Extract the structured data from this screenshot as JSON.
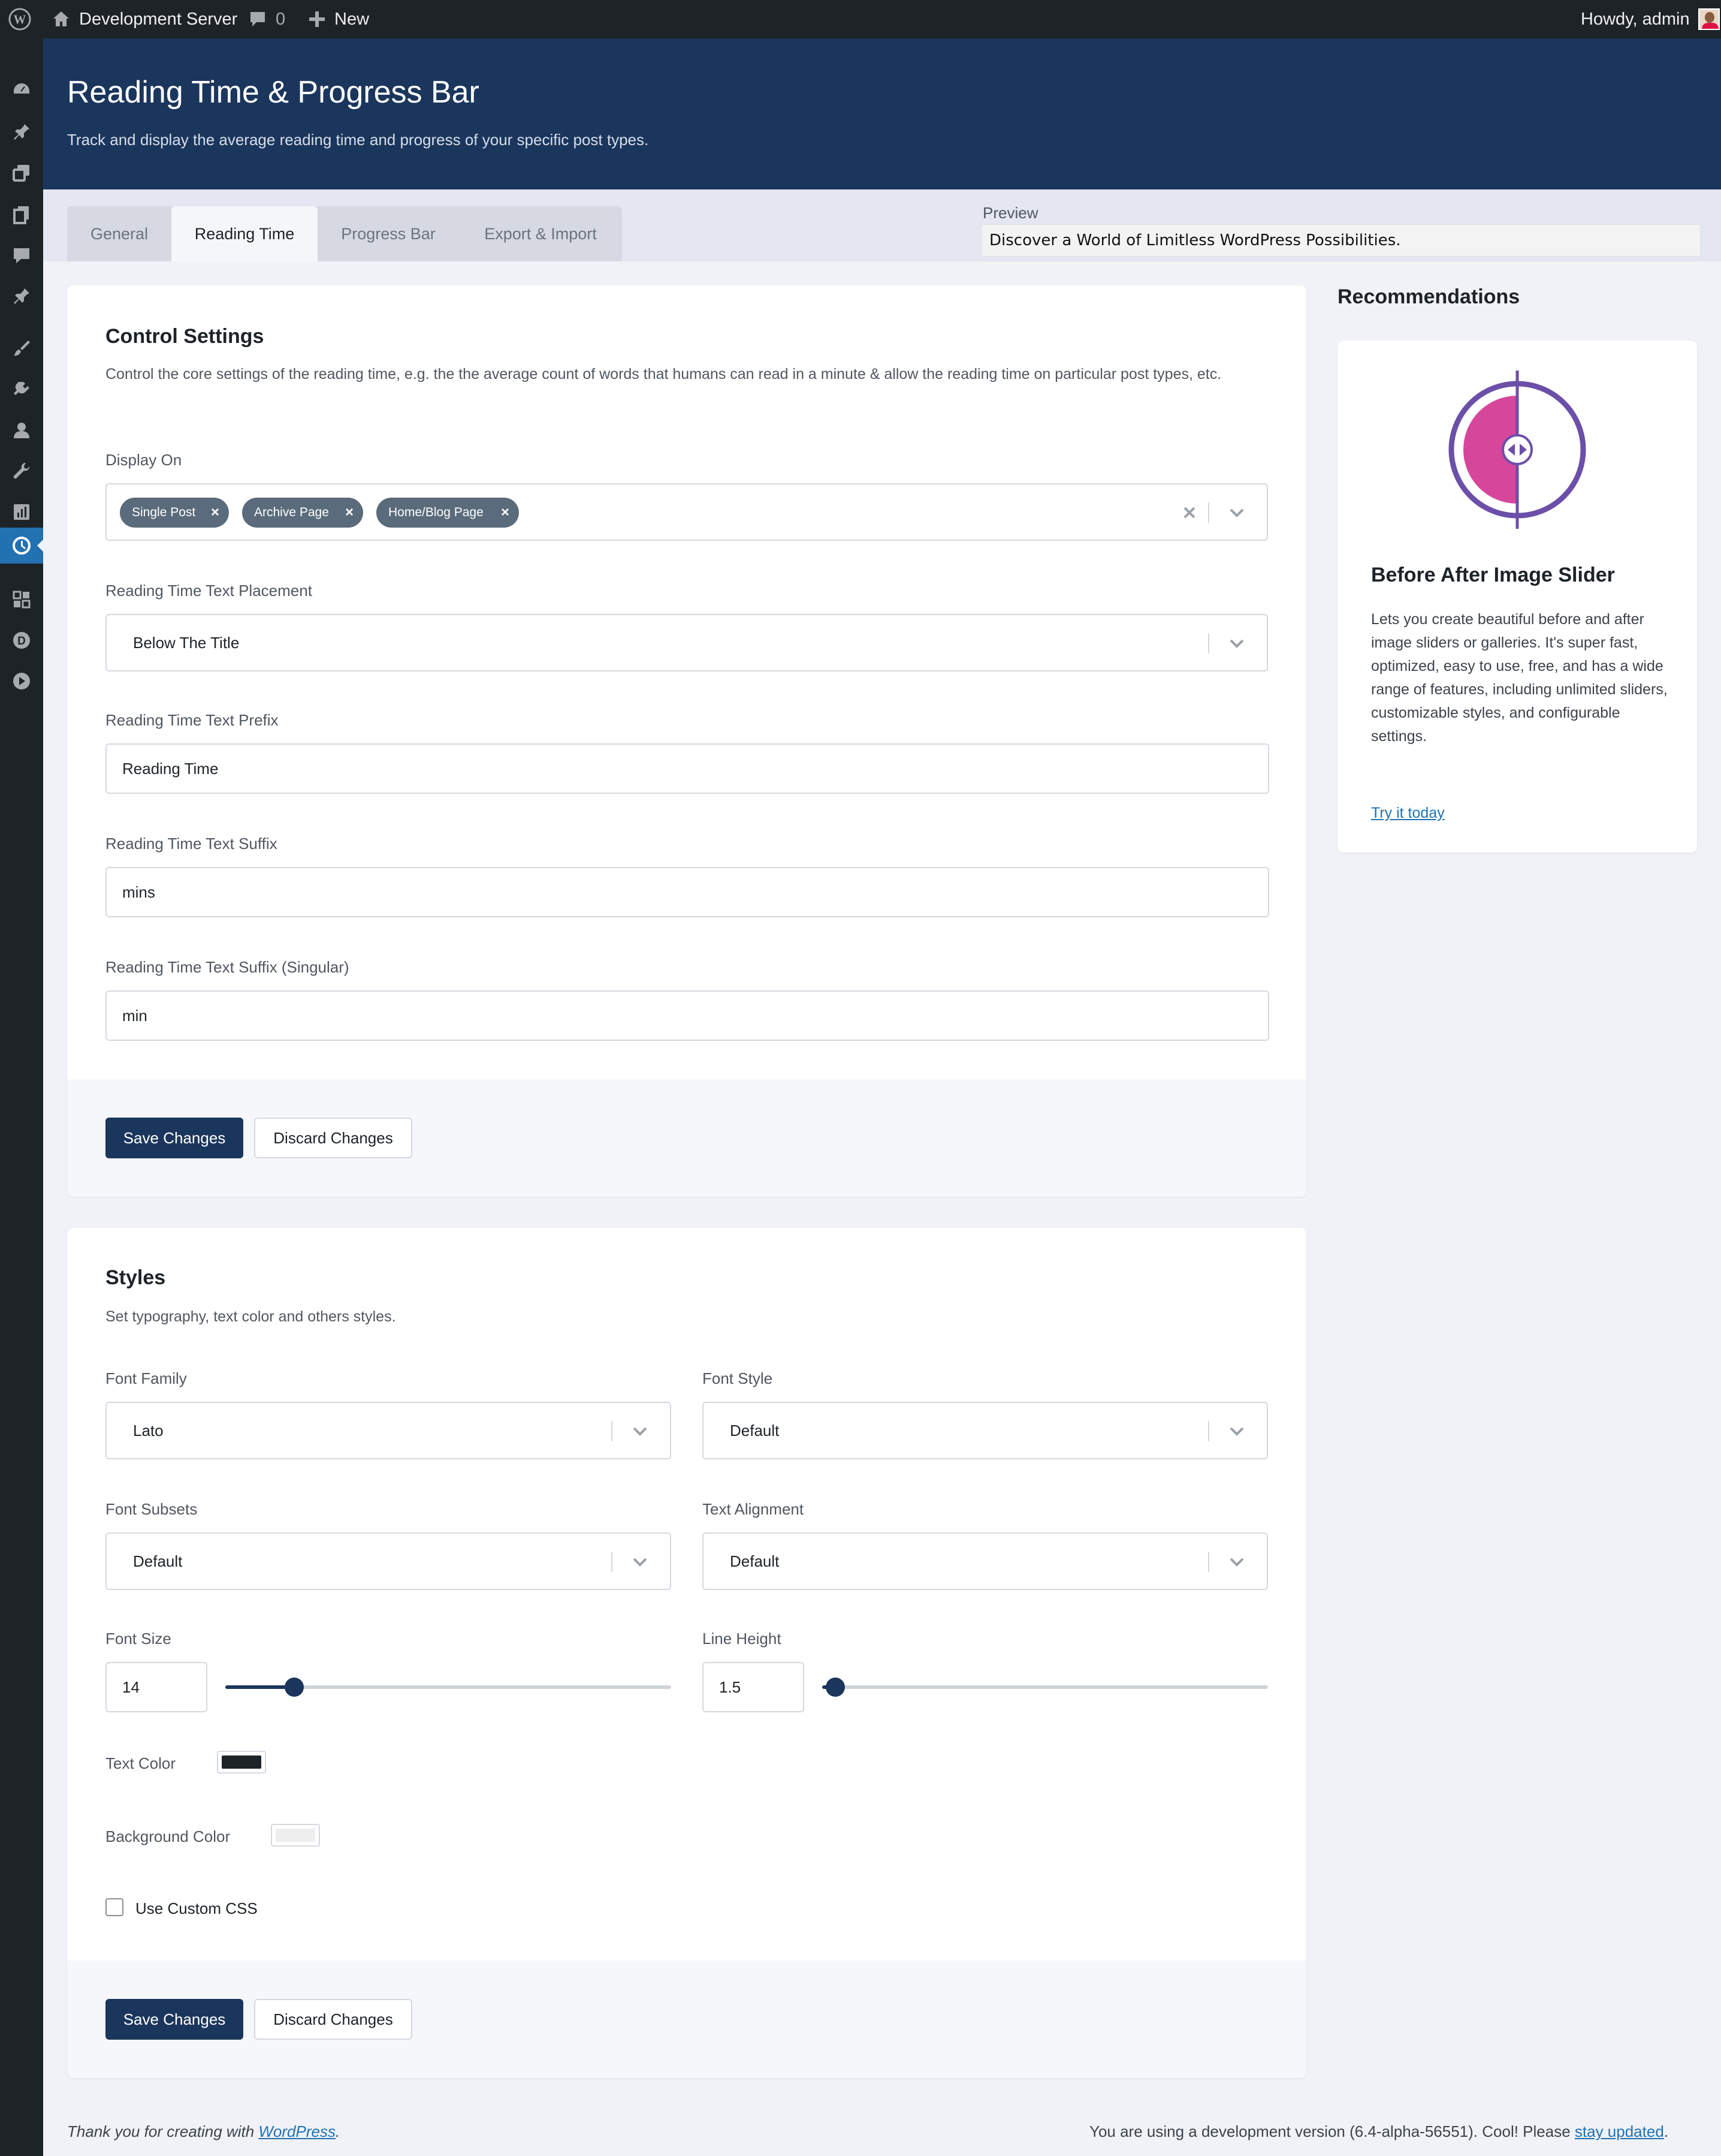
{
  "adminbar": {
    "site_name": "Development Server",
    "comments_count": "0",
    "new_label": "New",
    "greeting": "Howdy, admin"
  },
  "sidemenu": {
    "icons": [
      "dashboard-icon",
      "posts-icon",
      "media-icon",
      "pages-icon",
      "comments-icon",
      "pin-icon",
      "appearance-icon",
      "plugins-icon",
      "users-icon",
      "tools-icon",
      "settings-icon",
      "reading-time-icon",
      "blocks-icon",
      "d-plugin-icon",
      "play-icon"
    ],
    "active": "reading-time-icon"
  },
  "header": {
    "title": "Reading Time & Progress Bar",
    "subtitle": "Track and display the average reading time and progress of your specific post types."
  },
  "tabs": [
    {
      "label": "General",
      "active": false
    },
    {
      "label": "Reading Time",
      "active": true
    },
    {
      "label": "Progress Bar",
      "active": false
    },
    {
      "label": "Export & Import",
      "active": false
    }
  ],
  "preview": {
    "label": "Preview",
    "text": "Discover a World of Limitless WordPress Possibilities."
  },
  "control": {
    "title": "Control Settings",
    "description": "Control the core settings of the reading time, e.g. the the average count of words that humans can read in a minute & allow the reading time on particular post types, etc.",
    "display_on_label": "Display On",
    "display_on_chips": [
      "Single Post",
      "Archive Page",
      "Home/Blog Page"
    ],
    "placement_label": "Reading Time Text Placement",
    "placement_value": "Below The Title",
    "prefix_label": "Reading Time Text Prefix",
    "prefix_value": "Reading Time",
    "suffix_label": "Reading Time Text Suffix",
    "suffix_value": "mins",
    "suffix_singular_label": "Reading Time Text Suffix (Singular)",
    "suffix_singular_value": "min"
  },
  "buttons": {
    "save": "Save Changes",
    "discard": "Discard Changes"
  },
  "styles": {
    "title": "Styles",
    "description": "Set typography, text color and others styles.",
    "font_family_label": "Font Family",
    "font_family_value": "Lato",
    "font_style_label": "Font Style",
    "font_style_value": "Default",
    "font_subsets_label": "Font Subsets",
    "font_subsets_value": "Default",
    "text_alignment_label": "Text Alignment",
    "text_alignment_value": "Default",
    "font_size_label": "Font Size",
    "font_size_value": "14",
    "font_size_fraction": 0.155,
    "line_height_label": "Line Height",
    "line_height_value": "1.5",
    "line_height_fraction": 0.03,
    "text_color_label": "Text Color",
    "text_color": "#1d2327",
    "bg_color_label": "Background Color",
    "bg_color": "#eeeeee",
    "custom_css_label": "Use Custom CSS",
    "custom_css_checked": false
  },
  "recommendations": {
    "heading": "Recommendations",
    "title": "Before After Image Slider",
    "description": "Lets you create beautiful before and after image sliders or galleries. It's super fast, optimized, easy to use, free, and has a wide range of features, including unlimited sliders, customizable styles, and configurable settings.",
    "link": "Try it today"
  },
  "footer": {
    "left_prefix": "Thank you for creating with ",
    "left_link": "WordPress",
    "left_suffix": ".",
    "right_prefix": "You are using a development version (6.4-alpha-56551). Cool! Please ",
    "right_link": "stay updated",
    "right_suffix": "."
  },
  "colors": {
    "brand": "#1b365d",
    "admin_bar": "#1d2327",
    "active_menu": "#2271b1",
    "recommendation_pink": "#d6469b",
    "recommendation_purple": "#6b4fa8"
  }
}
